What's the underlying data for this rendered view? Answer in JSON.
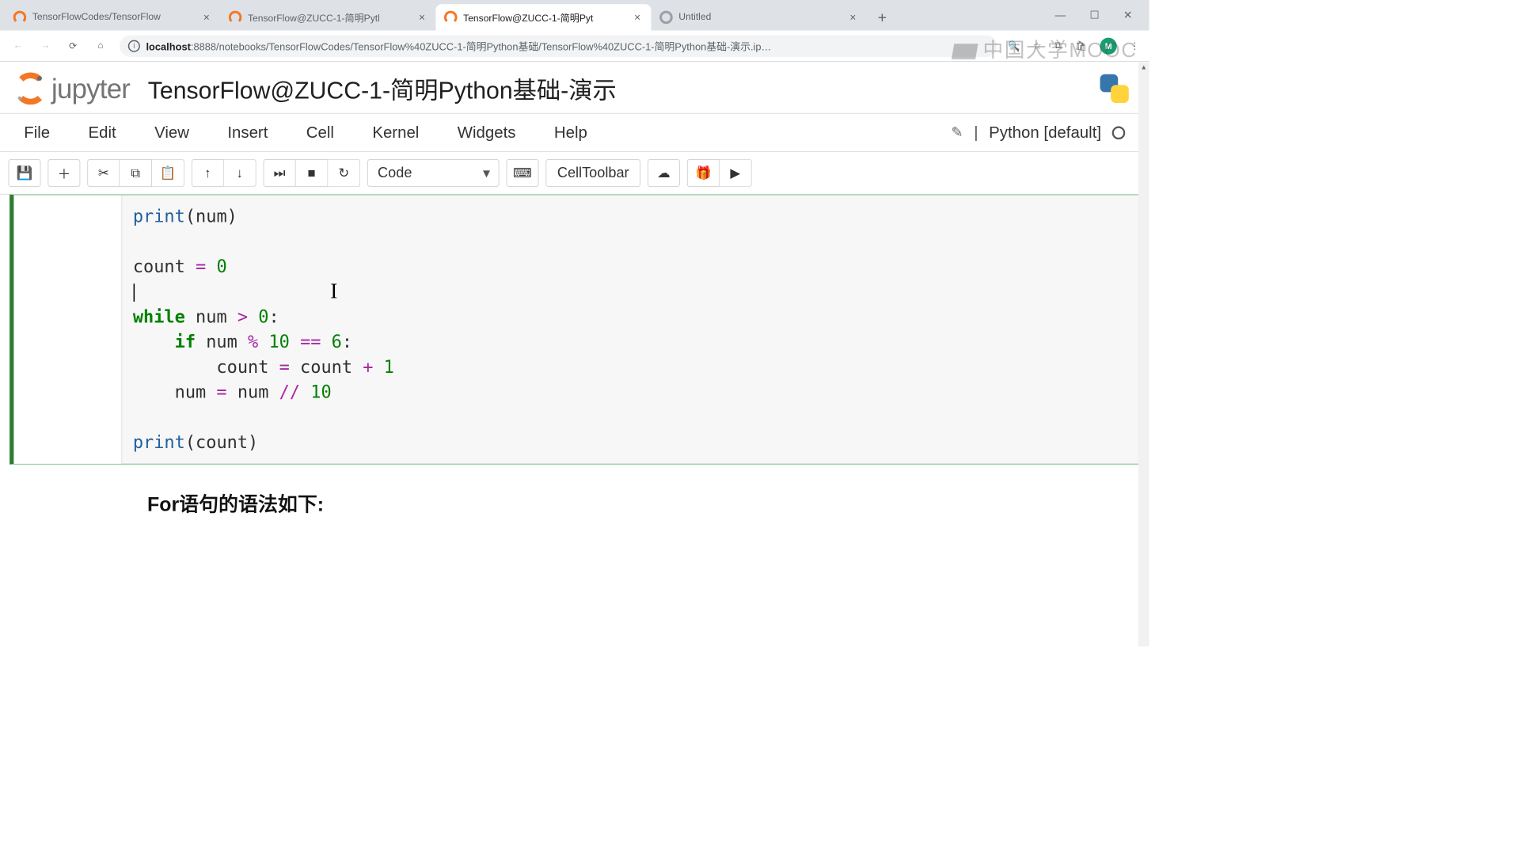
{
  "browser": {
    "tabs": [
      {
        "title": "TensorFlowCodes/TensorFlow",
        "active": false
      },
      {
        "title": "TensorFlow@ZUCC-1-简明Pytl",
        "active": false
      },
      {
        "title": "TensorFlow@ZUCC-1-简明Pyt",
        "active": true
      },
      {
        "title": "Untitled",
        "active": false
      }
    ],
    "url_host": "localhost",
    "url_port_path": ":8888/notebooks/TensorFlowCodes/TensorFlow%40ZUCC-1-简明Python基础/TensorFlow%40ZUCC-1-简明Python基础-演示.ip…",
    "avatar_letter": "M"
  },
  "watermark": "中国大学MOOC",
  "jupyter": {
    "logo_text": "jupyter",
    "notebook_name": "TensorFlow@ZUCC-1-简明Python基础-演示",
    "kernel_name": "Python [default]"
  },
  "menu": {
    "file": "File",
    "edit": "Edit",
    "view": "View",
    "insert": "Insert",
    "cell": "Cell",
    "kernel": "Kernel",
    "widgets": "Widgets",
    "help": "Help"
  },
  "toolbar": {
    "celltype": "Code",
    "celltoolbar": "CellToolbar"
  },
  "code": {
    "l1_fn": "print",
    "l1_rest": "(num)",
    "l3a": "count ",
    "l3_eq": "=",
    "l3b": " ",
    "l3_num": "0",
    "l5_kw": "while",
    "l5a": " num ",
    "l5_op": ">",
    "l5b": " ",
    "l5_num": "0",
    "l5c": ":",
    "l6_pad": "    ",
    "l6_kw": "if",
    "l6a": " num ",
    "l6_op1": "%",
    "l6b": " ",
    "l6_n1": "10",
    "l6c": " ",
    "l6_op2": "==",
    "l6d": " ",
    "l6_n2": "6",
    "l6e": ":",
    "l7_pad": "        ",
    "l7a": "count ",
    "l7_eq": "=",
    "l7b": " count ",
    "l7_plus": "+",
    "l7c": " ",
    "l7_n": "1",
    "l8_pad": "    ",
    "l8a": "num ",
    "l8_eq": "=",
    "l8b": " num ",
    "l8_op": "//",
    "l8c": " ",
    "l8_n": "10",
    "l10_fn": "print",
    "l10_rest": "(count)"
  },
  "markdown": {
    "heading": "For语句的语法如下:"
  }
}
